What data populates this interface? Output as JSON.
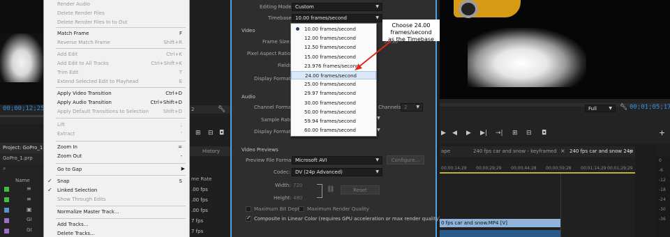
{
  "left_monitor": {
    "timecode": "00;00;12;25"
  },
  "project": {
    "title": "Project: GoPro_1",
    "file": "GoPro_1.prp",
    "name_col": "Name",
    "rate_col": "me Rate",
    "rates": [
      ".00 fps",
      ".00 fps",
      ".00 fps",
      "7 fps",
      "7 fps",
      "7 fps"
    ]
  },
  "menu": {
    "items": [
      {
        "label": "Render Audio",
        "shortcut": "",
        "disabled": true
      },
      {
        "label": "Delete Render Files",
        "shortcut": "",
        "disabled": true
      },
      {
        "label": "Delete Render Files In to Out",
        "shortcut": "",
        "disabled": true
      },
      {
        "label": "Match Frame",
        "shortcut": "F",
        "disabled": false
      },
      {
        "label": "Reverse Match Frame",
        "shortcut": "Shift+R",
        "disabled": true
      },
      {
        "label": "Add Edit",
        "shortcut": "Ctrl+K",
        "disabled": true
      },
      {
        "label": "Add Edit to All Tracks",
        "shortcut": "Ctrl+Shift+K",
        "disabled": true
      },
      {
        "label": "Trim Edit",
        "shortcut": "T",
        "disabled": true
      },
      {
        "label": "Extend Selected Edit to Playhead",
        "shortcut": "E",
        "disabled": true
      },
      {
        "label": "Apply Video Transition",
        "shortcut": "Ctrl+D",
        "disabled": false
      },
      {
        "label": "Apply Audio Transition",
        "shortcut": "Ctrl+Shift+D",
        "disabled": false
      },
      {
        "label": "Apply Default Transitions to Selection",
        "shortcut": "Shift+D",
        "disabled": true
      },
      {
        "label": "Lift",
        "shortcut": ";",
        "disabled": true
      },
      {
        "label": "Extract",
        "shortcut": "'",
        "disabled": true
      },
      {
        "label": "Zoom In",
        "shortcut": "=",
        "disabled": false
      },
      {
        "label": "Zoom Out",
        "shortcut": "-",
        "disabled": false
      },
      {
        "label": "Go to Gap",
        "shortcut": "",
        "disabled": false,
        "submenu": true
      },
      {
        "label": "Snap",
        "shortcut": "S",
        "disabled": false,
        "checked": true
      },
      {
        "label": "Linked Selection",
        "shortcut": "",
        "disabled": false,
        "checked": true
      },
      {
        "label": "Show Through Edits",
        "shortcut": "",
        "disabled": true
      },
      {
        "label": "Normalize Master Track...",
        "shortcut": "",
        "disabled": false
      },
      {
        "label": "Add Tracks...",
        "shortcut": "",
        "disabled": false
      },
      {
        "label": "Delete Tracks...",
        "shortcut": "",
        "disabled": false
      }
    ]
  },
  "mid_strip": {
    "value": "2",
    "history": "History"
  },
  "dialog": {
    "editing_mode_label": "Editing Mode:",
    "editing_mode_value": "Custom",
    "timebase_label": "Timebase:",
    "timebase_value": "10.00 frames/second",
    "video_section": "Video",
    "frame_size_label": "Frame Size:",
    "frame_size_partial": "53:30",
    "pixel_aspect_label": "Pixel Aspect Ratio:",
    "fields_label": "Fields:",
    "display_format_label": "Display Format:",
    "audio_section": "Audio",
    "channel_format_label": "Channel Format:",
    "channels_label": "Channels:",
    "channels_value": "2",
    "sample_rate_label": "Sample Rate:",
    "audio_display_format_label": "Display Format:",
    "video_previews_section": "Video Previews",
    "preview_format_label": "Preview File Format:",
    "preview_format_value": "Microsoft AVI",
    "configure_button": "Configure...",
    "codec_label": "Codec:",
    "codec_value": "DV (24p Advanced)",
    "width_label": "Width:",
    "width_value": "720",
    "height_label": "Height:",
    "height_value": "480",
    "reset_button": "Reset",
    "max_bit_depth": "Maximum Bit Depth",
    "max_render_quality": "Maximum Render Quality",
    "composite_linear": "Composite in Linear Color (requires GPU acceleration or max render quality)"
  },
  "timebase_options": [
    "10.00 frames/second",
    "12.00 frames/second",
    "12.50 frames/second",
    "15.00 frames/second",
    "23.976 frames/second",
    "24.00 frames/second",
    "25.00 frames/second",
    "29.97 frames/second",
    "30.00 frames/second",
    "50.00 frames/second",
    "59.94 frames/second",
    "60.00 frames/second"
  ],
  "timebase_selected_index": 0,
  "timebase_highlight_index": 5,
  "callout": {
    "line1": "Choose 24.00 frames/second",
    "line2": "as the Timebase"
  },
  "program_monitor": {
    "zoom": "Full",
    "timecode": "00;01;05;17"
  },
  "timeline": {
    "tabs": [
      "ape",
      "240 fps car and snow - keyframed",
      "240 fps car and snow 24p"
    ],
    "ruler": [
      "00;00;14;29",
      "00;00;29;29",
      "00;00;44;28",
      "00;00;59;28",
      "00;01;14;29",
      "00;01;29;29",
      "00;01;44;29"
    ],
    "clip_name": "0 fps car and snow.MP4 [V]",
    "meter_labels": [
      "0",
      "-6",
      "-12",
      "-18",
      "-24",
      "-30",
      "-36"
    ]
  },
  "colors": {
    "accent_blue": "#2f8fdd",
    "dialog_border": "#4aa3e8",
    "arrow_red": "#e0281e"
  }
}
